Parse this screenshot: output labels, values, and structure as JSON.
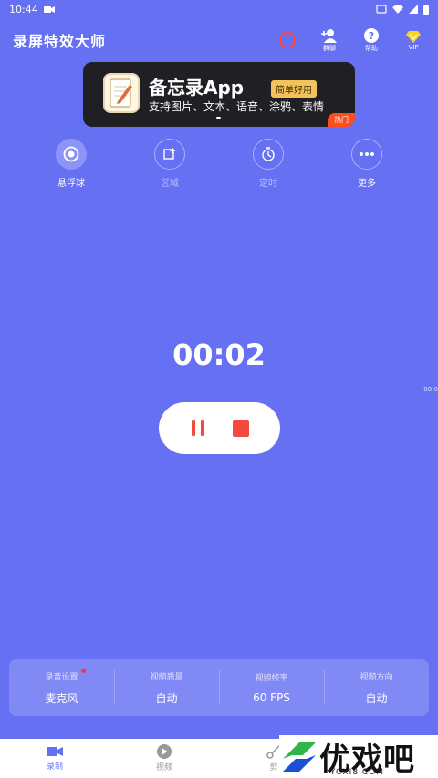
{
  "status_bar": {
    "time": "10:44",
    "icons": [
      "video-camera-icon",
      "cast-icon",
      "wifi-icon",
      "signal-icon",
      "battery-icon"
    ]
  },
  "app_bar": {
    "title": "录屏特效大师",
    "actions": [
      {
        "icon": "alert-circle-icon",
        "label": ""
      },
      {
        "icon": "add-user-icon",
        "label": "群聊"
      },
      {
        "icon": "help-icon",
        "label": "帮助"
      },
      {
        "icon": "vip-diamond-icon",
        "label": "VIP"
      }
    ]
  },
  "banner": {
    "title": "备忘录App",
    "tag": "简单好用",
    "subtitle": "支持图片、文本、语音、涂鸦、表情",
    "badge": "热门"
  },
  "tools": [
    {
      "label": "悬浮球",
      "icon": "target-icon",
      "active": true
    },
    {
      "label": "区域",
      "icon": "crop-add-icon",
      "active": false
    },
    {
      "label": "定时",
      "icon": "timer-icon",
      "active": false
    },
    {
      "label": "更多",
      "icon": "more-icon",
      "active": true
    }
  ],
  "recording": {
    "timer": "00:02",
    "side_time": "00:0"
  },
  "settings": [
    {
      "label": "录音设置",
      "value": "麦克风",
      "dot": true
    },
    {
      "label": "视频质量",
      "value": "自动",
      "dot": false
    },
    {
      "label": "视频帧率",
      "value": "60 FPS",
      "dot": false
    },
    {
      "label": "视频方向",
      "value": "自动",
      "dot": false
    }
  ],
  "tabs": [
    {
      "label": "录制",
      "icon": "camera-record-icon"
    },
    {
      "label": "视频",
      "icon": "play-circle-icon"
    },
    {
      "label": "剪",
      "icon": "scissors-icon"
    }
  ],
  "watermark": {
    "text": "优戏吧",
    "sub": "YOXI8.COM"
  },
  "colors": {
    "background": "#6670f2",
    "accent": "#f24a3f",
    "banner_bg": "#1f1f24",
    "tag": "#f2c35a",
    "hot": "#ff4d1f"
  }
}
